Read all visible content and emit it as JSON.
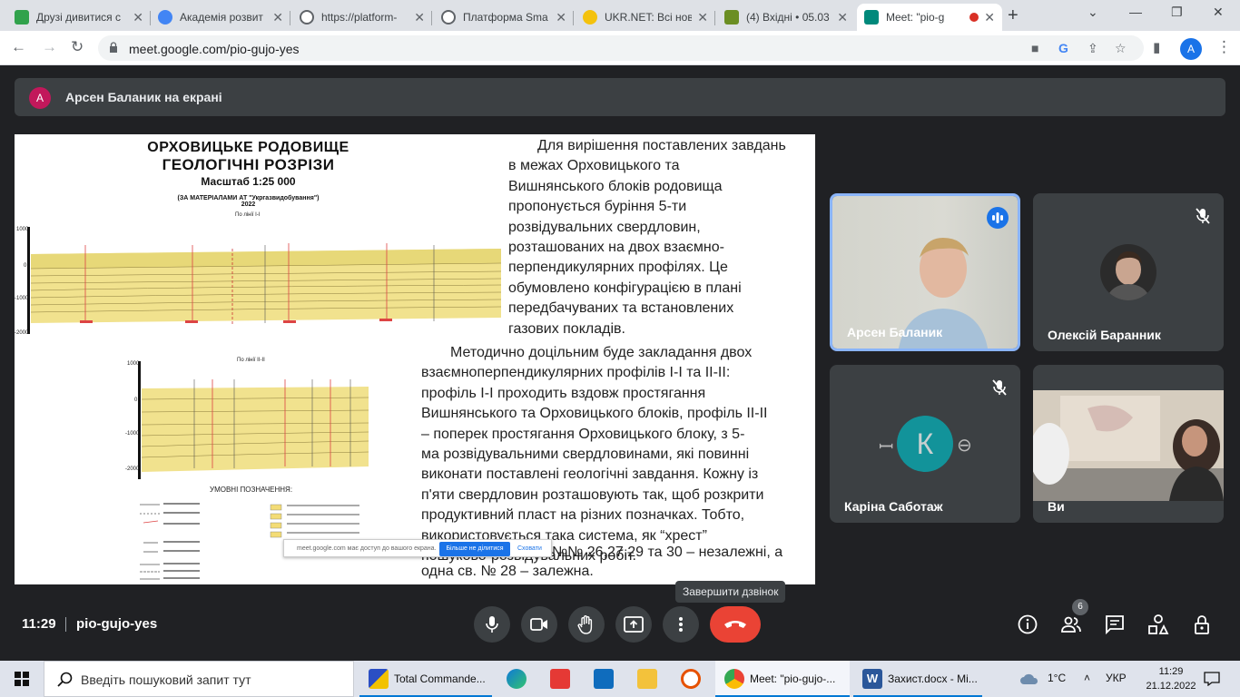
{
  "browser": {
    "tabs": [
      {
        "title": "Друзі дивитися с",
        "color": "#31a24c"
      },
      {
        "title": "Академія розвит",
        "color": "#4285f4"
      },
      {
        "title": "https://platform-",
        "color": "#5f6368"
      },
      {
        "title": "Платформа Sma",
        "color": "#5f6368"
      },
      {
        "title": "UKR.NET: Всі нов",
        "color": "#f4c20d"
      },
      {
        "title": "(4) Вхідні • 05.03",
        "color": "#6b8e23"
      },
      {
        "title": "Meet: \"pio-g",
        "color": "#00897b"
      }
    ],
    "url": "meet.google.com/pio-gujo-yes",
    "profile_letter": "A"
  },
  "banner": {
    "avatar_letter": "A",
    "text": "Арсен Баланик на екрані"
  },
  "slide": {
    "map": {
      "title1": "ОРХОВИЦЬКЕ РОДОВИЩЕ",
      "title2": "ГЕОЛОГІЧНІ РОЗРІЗИ",
      "scale": "Масштаб 1:25 000",
      "source": "(ЗА МАТЕРІАЛАМИ АТ \"Укргазвидобування\")",
      "year": "2022",
      "profile1": "По лінії І-І",
      "profile2": "По лінії ІІ-ІІ",
      "legend": "УМОВНІ ПОЗНАЧЕННЯ:",
      "depths1": [
        "1000",
        "0",
        "-1000",
        "-2000"
      ],
      "depths2": [
        "1000",
        "0",
        "-1000",
        "-2000"
      ]
    },
    "para1_lines": [
      "Для вирішення поставлених завдань",
      "в межах Орховицького та",
      "Вишнянського блоків родовища",
      "пропонується буріння 5-ти",
      "розвідувальних свердловин,",
      "розташованих на двох взаємно-",
      "перпендикулярних профілях. Це",
      "обумовлено конфігурацією в плані",
      "передбачуваних та встановлених",
      "газових покладів."
    ],
    "para2_lines": [
      "Методично доцільним буде закладання двох",
      "взаємноперпендикулярних профілів І-І та ІІ-ІІ:",
      "профіль І-І проходить вздовж простягання",
      "Вишнянського та Орховицького блоків, профіль ІІ-ІІ",
      "– поперек простягання Орховицького блоку, з 5-",
      "ма розвідувальними свердловинами, які повинні",
      "виконати поставлені геологічні завдання. Кожну із",
      "п'яти свердловин розташовують так, щоб розкрити",
      "продуктивний пласт на різних позначках. Тобто,",
      "використовується така система, як “хрест”",
      "пошуково-розвідувальних робіт."
    ],
    "para3_line1": "№№ 26,27,29 та 30 – незалежні, а",
    "para3_line2": "одна св. № 28 – залежна.",
    "share_popup": {
      "message": "meet.google.com має доступ до вашого екрана.",
      "stop": "Більше не ділитися",
      "hide": "Сховати"
    }
  },
  "participants": [
    {
      "name": "Арсен Баланик",
      "speaking": true
    },
    {
      "name": "Олексій Баранник",
      "muted": true
    },
    {
      "name": "Каріна Саботаж",
      "muted": true,
      "avatar_letter": "К"
    },
    {
      "name": "Ви"
    }
  ],
  "bottom_bar": {
    "time": "11:29",
    "meeting_code": "pio-gujo-yes",
    "end_call_tooltip": "Завершити дзвінок",
    "people_count": "6"
  },
  "taskbar": {
    "search_placeholder": "Введіть пошуковий запит тут",
    "apps": [
      {
        "label": "Total Commande..."
      },
      {
        "label": "Meet: \"pio-gujo-..."
      },
      {
        "label": "Захист.docx - Mi..."
      }
    ],
    "temperature": "1°C",
    "language": "УКР",
    "clock_time": "11:29",
    "clock_date": "21.12.2022"
  },
  "colors": {
    "end_call": "#ea4335",
    "speaking_border": "#8ab4f8",
    "accent": "#1a73e8"
  }
}
